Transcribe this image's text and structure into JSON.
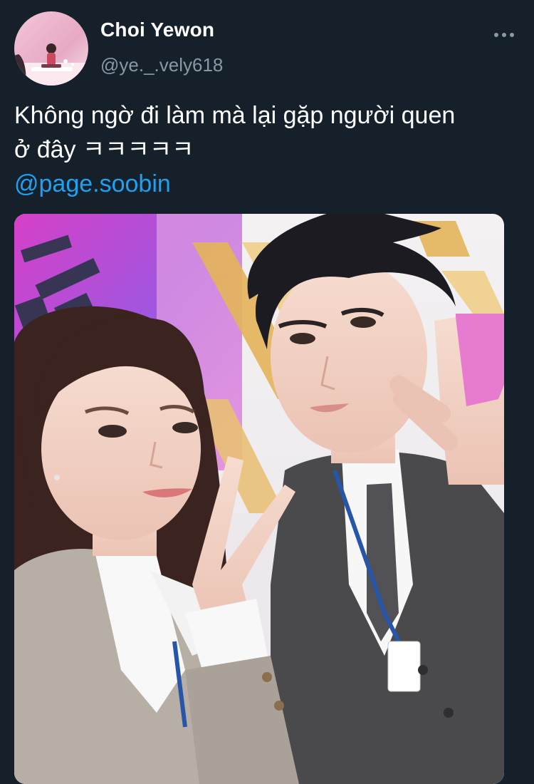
{
  "tweet": {
    "display_name": "Choi Yewon",
    "handle": "@ye._.vely618",
    "text_line1": "Không ngờ đi làm mà lại gặp người quen",
    "text_line2": "ở đây ㅋㅋㅋㅋㅋ",
    "mention": "@page.soobin"
  },
  "icons": {
    "more": "more-dots-icon"
  },
  "colors": {
    "background": "#15202b",
    "text_primary": "#ffffff",
    "text_secondary": "#8899a6",
    "link": "#1da1f2"
  }
}
